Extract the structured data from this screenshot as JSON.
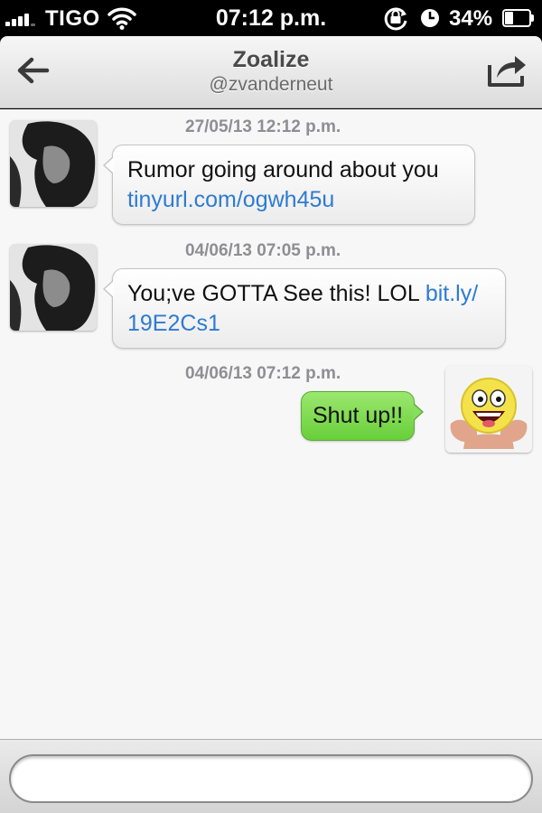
{
  "status_bar": {
    "carrier": "TIGO",
    "time": "07:12 p.m.",
    "battery_percent": "34%",
    "battery_level": 0.34,
    "icons": [
      "signal-icon",
      "wifi-icon",
      "rotation-lock-icon",
      "alarm-icon",
      "battery-icon"
    ]
  },
  "nav": {
    "title": "Zoalize",
    "subtitle": "@zvanderneut",
    "back_icon": "back-arrow-icon",
    "share_icon": "share-icon"
  },
  "messages": [
    {
      "timestamp": "27/05/13 12:12 p.m.",
      "direction": "incoming",
      "line1": "Rumor going around about you",
      "link": "tinyurl.com/ogwh45u"
    },
    {
      "timestamp": "04/06/13 07:05 p.m.",
      "direction": "incoming",
      "text": "You;ve GOTTA See this! LOL ",
      "link_part1": "bit.ly/",
      "link_part2": "19E2Cs1"
    },
    {
      "timestamp": "04/06/13 07:12 p.m.",
      "direction": "outgoing",
      "text": "Shut up!!"
    }
  ],
  "compose": {
    "value": "",
    "placeholder": ""
  },
  "colors": {
    "outgoing_bubble": "#7ad84b",
    "incoming_bubble": "#f7f7f7",
    "link": "#2e7bd1",
    "timestamp": "#8e8e93"
  }
}
